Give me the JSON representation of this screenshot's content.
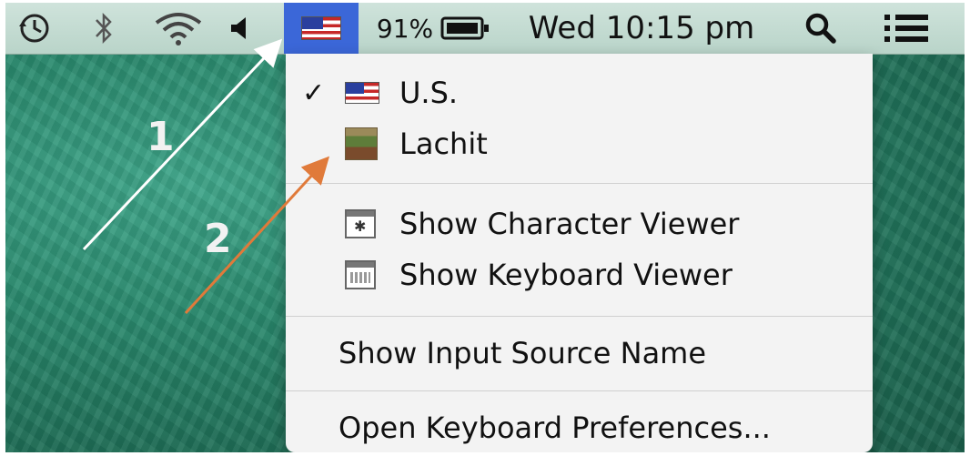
{
  "menubar": {
    "icons": [
      "time-machine-icon",
      "bluetooth-icon",
      "wifi-icon",
      "volume-icon"
    ],
    "input_source": "U.S.",
    "battery_percent": "91%",
    "clock": "Wed 10:15 pm"
  },
  "menu": {
    "sources": [
      {
        "label": "U.S.",
        "checked": true
      },
      {
        "label": "Lachit",
        "checked": false
      }
    ],
    "check_mark": "✓",
    "viewers": [
      {
        "label": "Show Character Viewer"
      },
      {
        "label": "Show Keyboard Viewer"
      }
    ],
    "show_input_source_name": "Show Input Source Name",
    "open_prefs": "Open Keyboard Preferences..."
  },
  "annotations": {
    "step1": "1",
    "step2": "2"
  },
  "colors": {
    "arrow1": "#ffffff",
    "arrow2": "#e07a3a",
    "selected_bg": "#3b67d8"
  }
}
